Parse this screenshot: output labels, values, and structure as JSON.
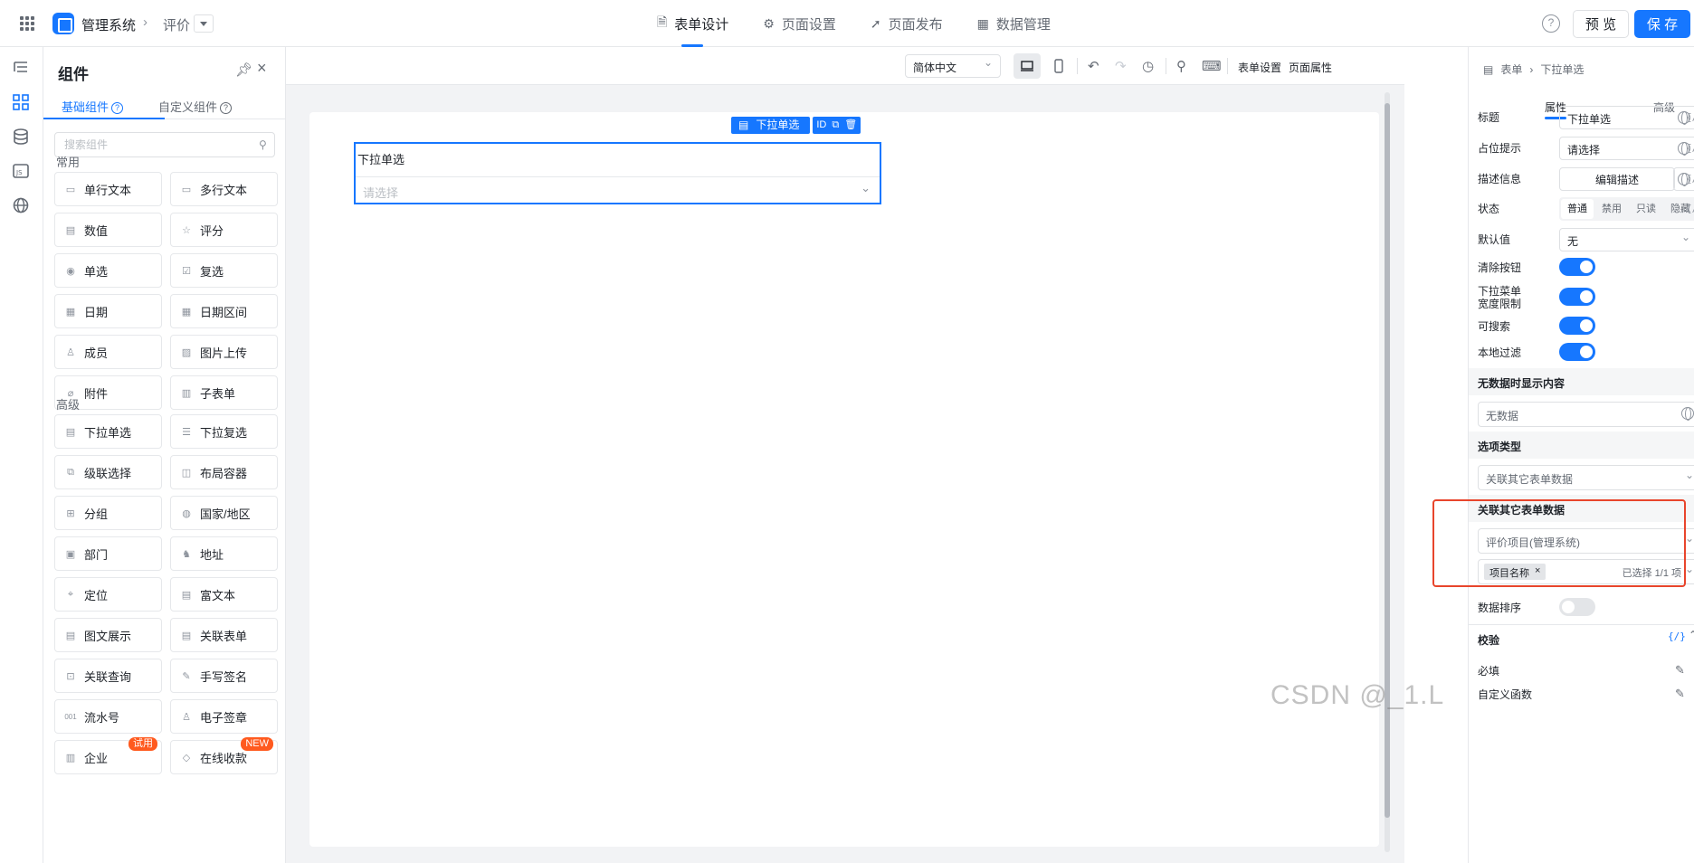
{
  "header": {
    "app_name": "管理系统",
    "page_name": "评价",
    "tabs": [
      {
        "label": "表单设计",
        "icon": "document-icon",
        "active": true
      },
      {
        "label": "页面设置",
        "icon": "gear-icon",
        "active": false
      },
      {
        "label": "页面发布",
        "icon": "send-icon",
        "active": false
      },
      {
        "label": "数据管理",
        "icon": "table-icon",
        "active": false
      }
    ],
    "help_label": "?",
    "preview_label": "预 览",
    "save_label": "保 存"
  },
  "components": {
    "title": "组件",
    "tab_basic": "基础组件",
    "tab_custom": "自定义组件",
    "search_placeholder": "搜索组件",
    "section_common": "常用",
    "common": [
      "单行文本",
      "多行文本",
      "数值",
      "评分",
      "单选",
      "复选",
      "日期",
      "日期区间",
      "成员",
      "图片上传",
      "附件",
      "子表单"
    ],
    "section_advanced": "高级",
    "advanced": [
      "下拉单选",
      "下拉复选",
      "级联选择",
      "布局容器",
      "分组",
      "国家/地区",
      "部门",
      "地址",
      "定位",
      "富文本",
      "图文展示",
      "关联表单",
      "关联查询",
      "手写签名",
      "流水号",
      "电子签章",
      "企业",
      "在线收款"
    ],
    "badge_trial": "试用",
    "badge_new": "NEW",
    "serial_icon_text": "001"
  },
  "toolbar": {
    "language": "简体中文",
    "form_settings": "表单设置",
    "page_props": "页面属性"
  },
  "canvas": {
    "field_tag": "下拉单选",
    "field_id": "ID",
    "field_label": "下拉单选",
    "field_placeholder": "请选择"
  },
  "props": {
    "crumb_root": "表单",
    "crumb_current": "下拉单选",
    "tab_props": "属性",
    "tab_advanced": "高级",
    "fx": "{/}",
    "title_label": "标题",
    "title_value": "下拉单选",
    "placeholder_label": "占位提示",
    "placeholder_value": "请选择",
    "desc_label": "描述信息",
    "desc_button": "编辑描述",
    "state_label": "状态",
    "states": [
      "普通",
      "禁用",
      "只读",
      "隐藏"
    ],
    "default_label": "默认值",
    "default_value": "无",
    "clear_label": "清除按钮",
    "width_limit_label_1": "下拉菜单",
    "width_limit_label_2": "宽度限制",
    "searchable_label": "可搜索",
    "local_filter_label": "本地过滤",
    "no_data_section": "无数据时显示内容",
    "no_data_value": "无数据",
    "option_type_section": "选项类型",
    "option_type_value": "关联其它表单数据",
    "related_section": "关联其它表单数据",
    "related_form_value": "评价项目(管理系统)",
    "related_field_tag": "项目名称",
    "related_count": "已选择 1/1 项",
    "sort_label": "数据排序",
    "validate_section": "校验",
    "required_label": "必填",
    "custom_fn_label": "自定义函数",
    "toggles": {
      "clear": true,
      "width_limit": true,
      "searchable": true,
      "local_filter": true,
      "sort": false
    }
  },
  "watermark": "CSDN @_1.L",
  "colors": {
    "accent": "#1677ff",
    "highlight": "#e8452c",
    "badge": "#ff5a1f"
  }
}
